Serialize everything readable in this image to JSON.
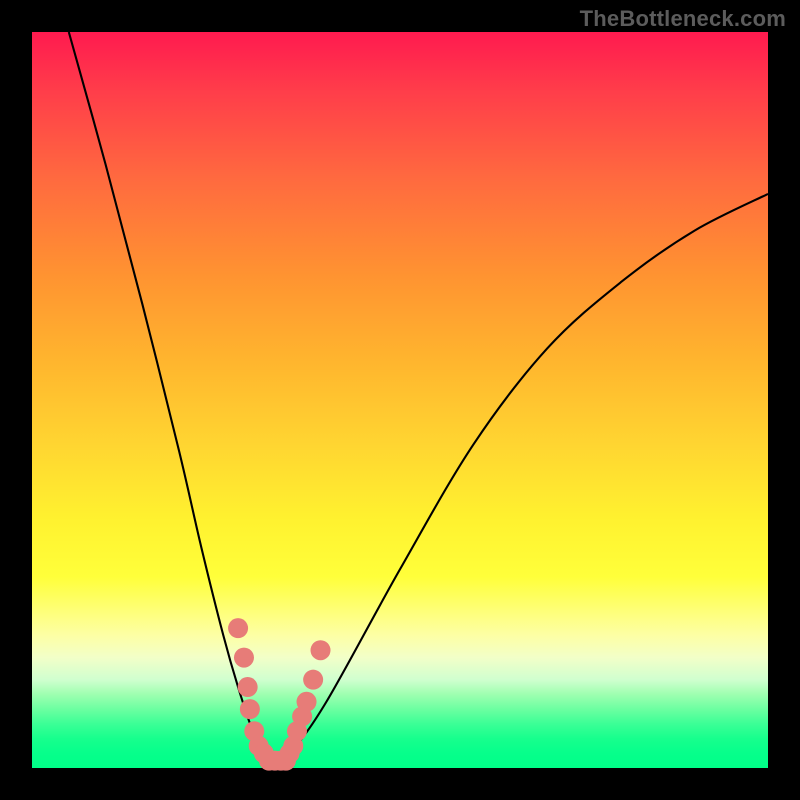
{
  "watermark": "TheBottleneck.com",
  "colors": {
    "marker": "#e77c78",
    "curve": "#000000"
  },
  "chart_data": {
    "type": "line",
    "title": "",
    "xlabel": "",
    "ylabel": "",
    "xlim": [
      0,
      100
    ],
    "ylim": [
      0,
      100
    ],
    "grid": false,
    "legend": false,
    "series": [
      {
        "name": "curve",
        "x": [
          5,
          10,
          15,
          20,
          23,
          26,
          28,
          30,
          31.5,
          33,
          35,
          40,
          50,
          60,
          70,
          80,
          90,
          100
        ],
        "values": [
          100,
          82,
          63,
          43,
          30,
          18,
          11,
          5,
          2,
          1,
          2,
          9,
          27,
          44,
          57,
          66,
          73,
          78
        ]
      }
    ],
    "markers": {
      "name": "highlighted-points",
      "note": "Pink markers near the valley minimum",
      "points": [
        {
          "x": 28.0,
          "y": 19.0
        },
        {
          "x": 28.8,
          "y": 15.0
        },
        {
          "x": 29.3,
          "y": 11.0
        },
        {
          "x": 29.6,
          "y": 8.0
        },
        {
          "x": 30.2,
          "y": 5.0
        },
        {
          "x": 30.8,
          "y": 3.0
        },
        {
          "x": 31.5,
          "y": 2.0
        },
        {
          "x": 32.2,
          "y": 1.0
        },
        {
          "x": 33.0,
          "y": 1.0
        },
        {
          "x": 33.8,
          "y": 1.0
        },
        {
          "x": 34.5,
          "y": 1.0
        },
        {
          "x": 35.0,
          "y": 2.0
        },
        {
          "x": 35.5,
          "y": 3.0
        },
        {
          "x": 36.0,
          "y": 5.0
        },
        {
          "x": 36.7,
          "y": 7.0
        },
        {
          "x": 37.3,
          "y": 9.0
        },
        {
          "x": 38.2,
          "y": 12.0
        },
        {
          "x": 39.2,
          "y": 16.0
        }
      ]
    }
  }
}
